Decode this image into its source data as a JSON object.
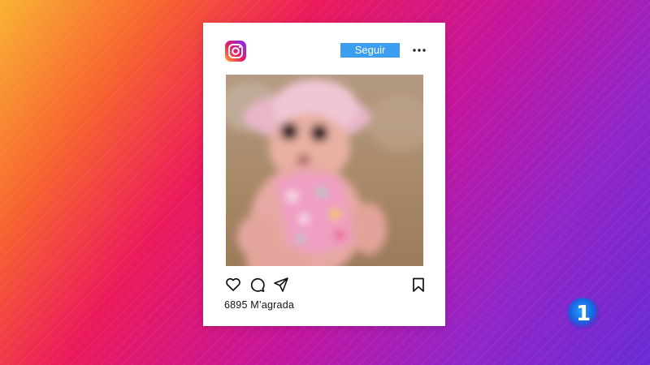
{
  "post": {
    "follow_label": "Seguir",
    "likes_text": "6895 M’agrada",
    "image_alt": "Foto borrosa d'un nadó amb barret i banyador de flors a la sorra"
  },
  "icons": {
    "app_logo": "instagram-logo-icon",
    "more": "more-options-icon",
    "like": "heart-icon",
    "comment": "comment-icon",
    "share": "share-icon",
    "save": "bookmark-icon"
  },
  "channel_logo": {
    "text": "1"
  },
  "colors": {
    "follow_button": "#3b9ef0",
    "card": "#ffffff",
    "gradient": [
      "#f9b233",
      "#ec1a5a",
      "#c4159d",
      "#6a2bd4"
    ]
  }
}
